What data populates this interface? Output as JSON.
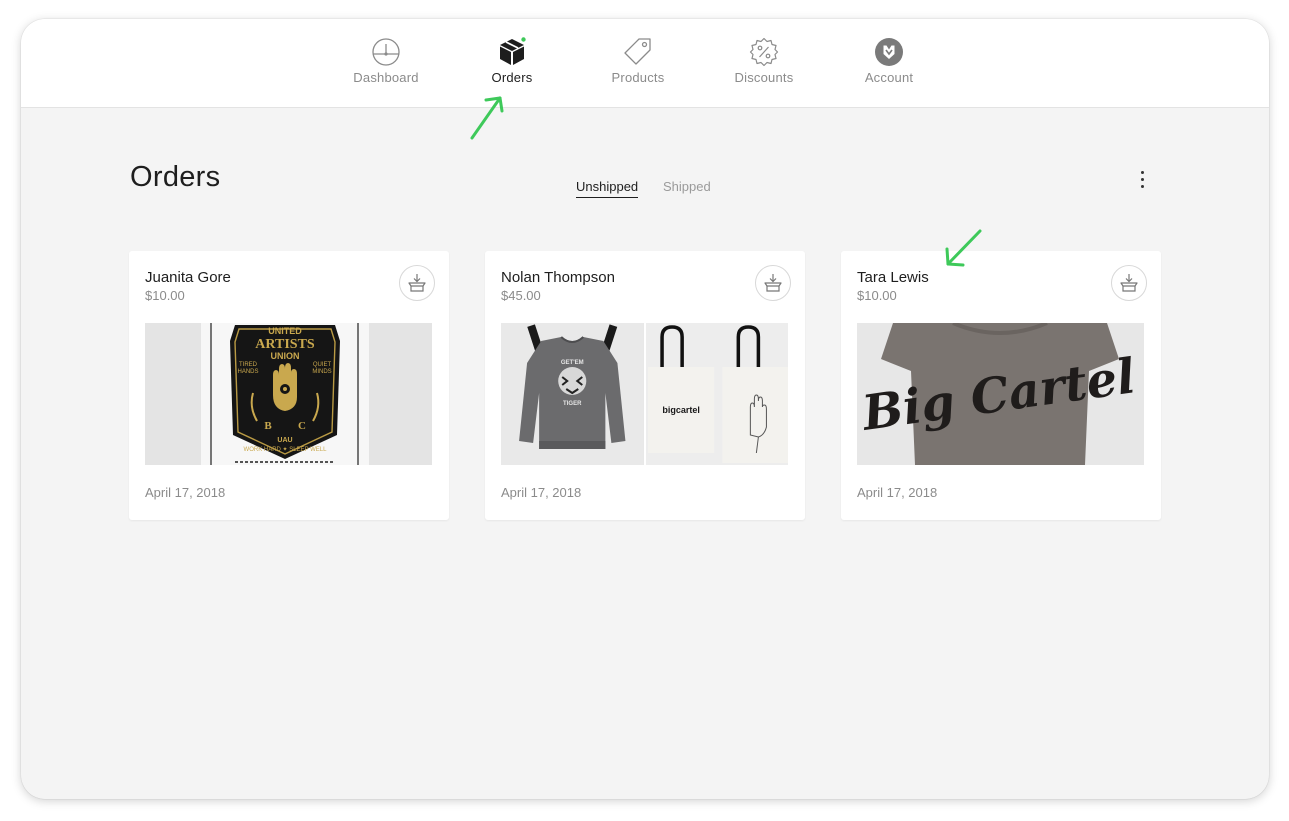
{
  "nav": {
    "items": [
      {
        "id": "dashboard",
        "label": "Dashboard",
        "icon": "dashboard-gauge-icon"
      },
      {
        "id": "orders",
        "label": "Orders",
        "icon": "box-icon",
        "active": true,
        "notification_dot": true
      },
      {
        "id": "products",
        "label": "Products",
        "icon": "tag-icon"
      },
      {
        "id": "discounts",
        "label": "Discounts",
        "icon": "percent-badge-icon"
      },
      {
        "id": "account",
        "label": "Account",
        "icon": "shield-logo-icon"
      }
    ]
  },
  "page": {
    "title": "Orders",
    "tabs": [
      {
        "label": "Unshipped",
        "active": true
      },
      {
        "label": "Shipped",
        "active": false
      }
    ],
    "more_icon": "vertical-ellipsis-icon"
  },
  "orders": [
    {
      "customer": "Juanita Gore",
      "total": "$10.00",
      "date": "April 17, 2018",
      "images": [
        "united-artists-union-poster"
      ]
    },
    {
      "customer": "Nolan Thompson",
      "total": "$45.00",
      "date": "April 17, 2018",
      "images": [
        "grey-tiger-sweatshirt",
        "bigcartel-tote-bags"
      ],
      "tote_text": "bigcartel"
    },
    {
      "customer": "Tara Lewis",
      "total": "$10.00",
      "date": "April 17, 2018",
      "images": [
        "big-cartel-tshirt"
      ]
    }
  ],
  "poster": {
    "line1": "UNITED",
    "line2": "ARTISTS",
    "line3": "UNION",
    "side_left_1": "TIRED",
    "side_left_2": "HANDS",
    "side_right_1": "QUIET",
    "side_right_2": "MINDS",
    "initials_left": "B",
    "initials_right": "C",
    "monogram": "UAU",
    "footer": "WORK HARD ✦ SLEEP WELL"
  },
  "shirt_lettering": "Big Cartel",
  "sweatshirt_text": [
    "GET'EM",
    "TIGER"
  ],
  "colors": {
    "accent_green": "#3ec95a",
    "text_dark": "#1e1e1e",
    "text_muted": "#8b8b8b",
    "background": "#f4f4f4",
    "card": "#ffffff"
  },
  "annotations": [
    "green-arrow-orders-tab",
    "green-arrow-customer-name"
  ]
}
